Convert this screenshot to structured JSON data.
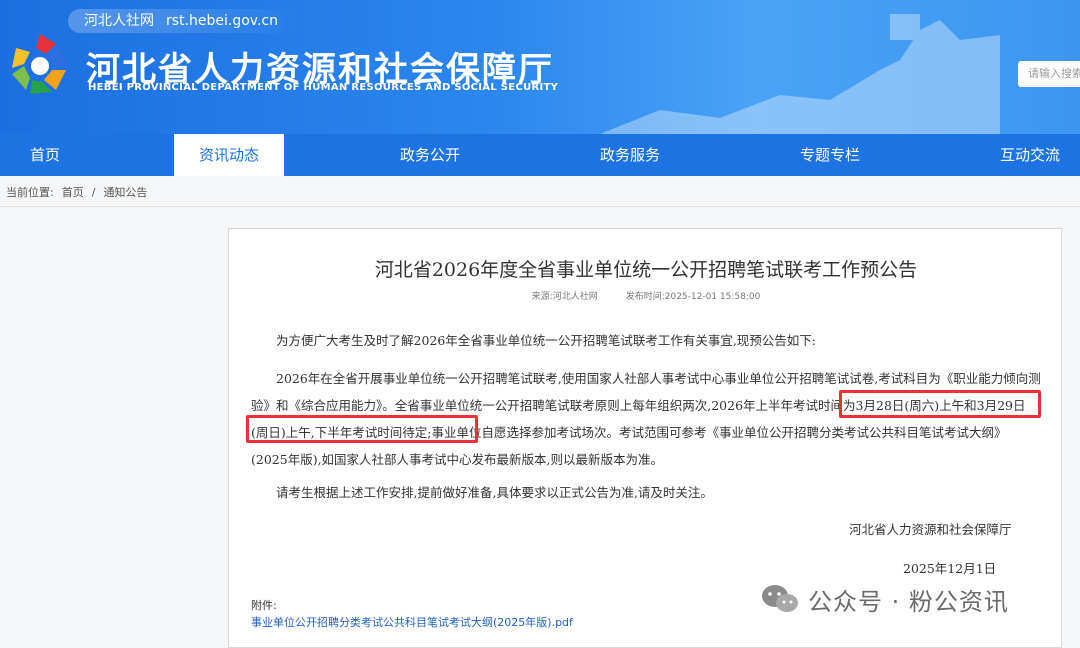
{
  "header": {
    "site_name": "河北人社网",
    "site_url": "rst.hebei.gov.cn",
    "title_cn": "河北省人力资源和社会保障厅",
    "title_en": "HEBEI PROVINCIAL DEPARTMENT OF HUMAN RESOURCES AND SOCIAL SECURITY",
    "search_placeholder": "请输入搜索"
  },
  "nav": {
    "items": [
      "首页",
      "资讯动态",
      "政务公开",
      "政务服务",
      "专题专栏",
      "互动交流"
    ],
    "active_index": 1
  },
  "breadcrumb": {
    "label": "当前位置:",
    "home": "首页",
    "separator": "/",
    "current": "通知公告"
  },
  "article": {
    "title": "河北省2026年度全省事业单位统一公开招聘笔试联考工作预公告",
    "source": "来源:河北人社网",
    "published": "发布时间:2025-12-01 15:58:00",
    "intro": "为方便广大考生及时了解2026年全省事业单位统一公开招聘笔试联考工作有关事宜,现预公告如下:",
    "body": "2026年在全省开展事业单位统一公开招聘笔试联考,使用国家人社部人事考试中心事业单位公开招聘笔试试卷,考试科目为《职业能力倾向测验》和《综合应用能力》。全省事业单位统一公开招聘笔试联考原则上每年组织两次,2026年上半年考试时间为3月28日(周六)上午和3月29日(周日)上午,下半年考试时间待定;事业单位自愿选择参加考试场次。考试范围可参考《事业单位公开招聘分类考试公共科目笔试考试大纲》(2025年版),如国家人社部人事考试中心发布最新版本,则以最新版本为准。",
    "notice": "请考生根据上述工作安排,提前做好准备,具体要求以正式公告为准,请及时关注。",
    "signature": "河北省人力资源和社会保障厅",
    "date": "2025年12月1日",
    "attachment_label": "附件:",
    "attachment_link": "事业单位公开招聘分类考试公共科目笔试考试大纲(2025年版).pdf"
  },
  "watermark": {
    "text": "公众号 · 粉公资讯"
  },
  "colors": {
    "header_blue": "#1e73e3",
    "highlight_red": "#e8323a",
    "link_blue": "#1e5fc8"
  }
}
